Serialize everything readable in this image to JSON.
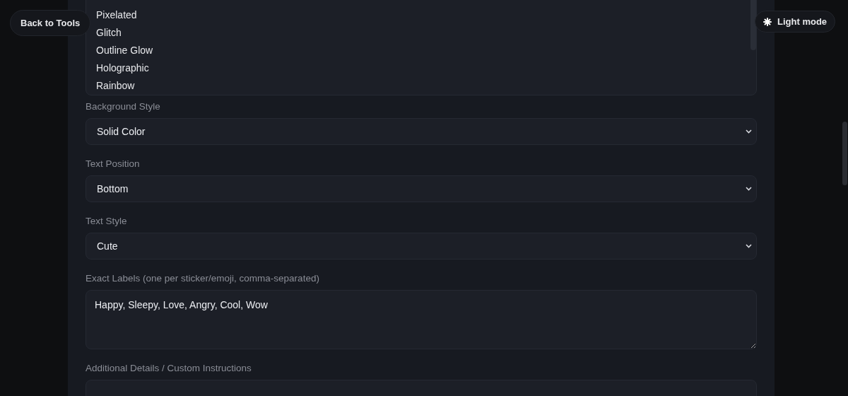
{
  "back_button": {
    "label": "Back to Tools"
  },
  "theme_button": {
    "label": "Light mode"
  },
  "effect_list": {
    "items": [
      {
        "label": "Pixelated",
        "selected": false
      },
      {
        "label": "Glitch",
        "selected": false
      },
      {
        "label": "Outline Glow",
        "selected": false
      },
      {
        "label": "Holographic",
        "selected": false
      },
      {
        "label": "Rainbow",
        "selected": false
      }
    ]
  },
  "fields": [
    {
      "kind": "select",
      "label": "Background Style",
      "value": "Solid Color"
    },
    {
      "kind": "select",
      "label": "Text Position",
      "value": "Bottom"
    },
    {
      "kind": "select",
      "label": "Text Style",
      "value": "Cute"
    },
    {
      "kind": "textarea",
      "label": "Exact Labels (one per sticker/emoji, comma-separated)",
      "value": "Happy, Sleepy, Love, Angry, Cool, Wow"
    },
    {
      "kind": "partial",
      "label": "Additional Details / Custom Instructions"
    }
  ]
}
